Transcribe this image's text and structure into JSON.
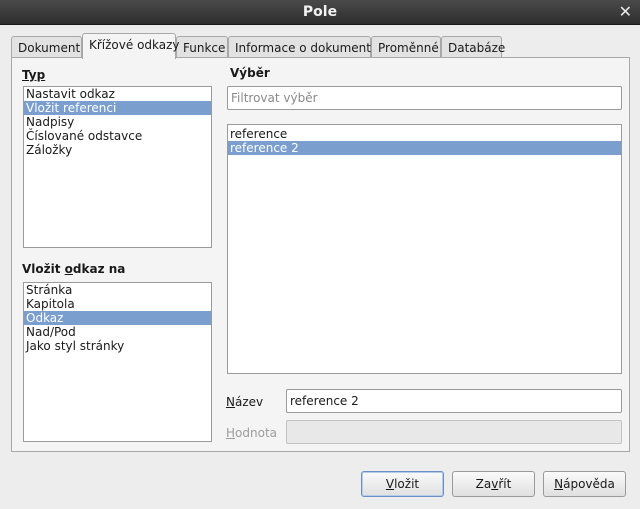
{
  "window": {
    "title": "Pole"
  },
  "tabs": [
    {
      "label": "Dokument"
    },
    {
      "label": "Křížové odkazy"
    },
    {
      "label": "Funkce"
    },
    {
      "label": "Informace o dokumentu"
    },
    {
      "label": "Proměnné"
    },
    {
      "label": "Databáze"
    }
  ],
  "type_section": {
    "label": "Typ",
    "items": [
      "Nastavit odkaz",
      "Vložit referenci",
      "Nadpisy",
      "Číslované odstavce",
      "Záložky"
    ],
    "selected_index": 1
  },
  "insert_ref_section": {
    "label_pre": "Vložit ",
    "label_accel": "o",
    "label_post": "dkaz na",
    "items": [
      "Stránka",
      "Kapitola",
      "Odkaz",
      "Nad/Pod",
      "Jako styl stránky"
    ],
    "selected_index": 2
  },
  "selection_section": {
    "label": "Výběr",
    "filter_placeholder": "Filtrovat výběr",
    "items": [
      "reference",
      "reference 2"
    ],
    "selected_index": 1
  },
  "name_field": {
    "label_accel": "N",
    "label_rest": "ázev",
    "value": "reference 2"
  },
  "value_field": {
    "label_accel": "H",
    "label_rest": "odnota",
    "value": ""
  },
  "buttons": {
    "insert": {
      "accel": "V",
      "rest": "ložit"
    },
    "close": {
      "pre": "Za",
      "accel": "v",
      "post": "řít"
    },
    "help": {
      "accel": "N",
      "rest": "ápověda"
    }
  }
}
